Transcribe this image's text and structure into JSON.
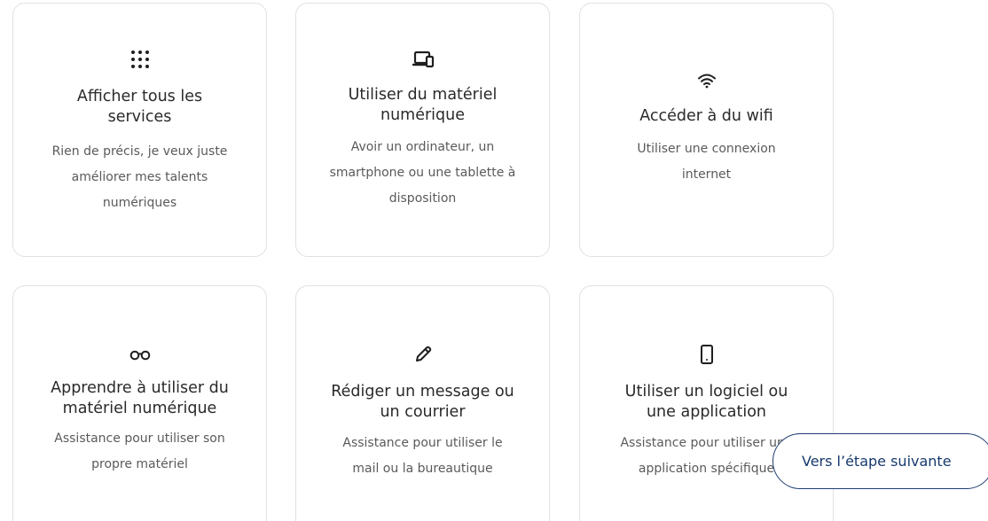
{
  "cards": [
    {
      "icon": "grid-dots-icon",
      "title": "Afficher tous les services",
      "title_lines": [
        "Afficher tous les",
        "services"
      ],
      "description_lines": [
        "Rien de précis, je veux juste",
        "améliorer mes talents",
        "numériques"
      ]
    },
    {
      "icon": "laptop-icon",
      "title_lines": [
        "Utiliser du matériel",
        "numérique"
      ],
      "description_lines": [
        "Avoir un ordinateur, un",
        "smartphone ou une tablette à",
        "disposition"
      ]
    },
    {
      "icon": "wifi-icon",
      "title_lines": [
        "Accéder à du wifi"
      ],
      "description_lines": [
        "Utiliser une connexion",
        "internet"
      ]
    },
    {
      "icon": "glasses-icon",
      "title_lines": [
        "Apprendre à utiliser du",
        "matériel numérique"
      ],
      "description_lines": [
        "Assistance pour utiliser son",
        "propre matériel"
      ]
    },
    {
      "icon": "pencil-icon",
      "title_lines": [
        "Rédiger un message ou",
        "un courrier"
      ],
      "description_lines": [
        "Assistance pour utiliser le",
        "mail ou la bureautique"
      ]
    },
    {
      "icon": "smartphone-icon",
      "title_lines": [
        "Utiliser un logiciel ou",
        "une application"
      ],
      "description_lines": [
        "Assistance pour utiliser une",
        "application spécifique"
      ]
    }
  ],
  "next_button_label": "Vers l’étape suivante",
  "colors": {
    "card_border": "#e1e1e1",
    "title": "#2a2a2a",
    "description": "#5a5a5a",
    "button_border": "#1f3e73",
    "button_text": "#173a6d"
  }
}
